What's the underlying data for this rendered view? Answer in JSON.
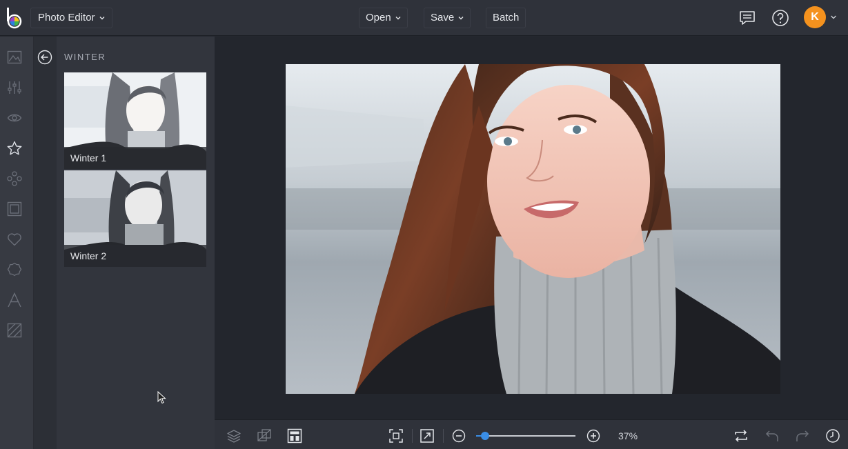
{
  "header": {
    "mode_label": "Photo Editor",
    "open_label": "Open",
    "save_label": "Save",
    "batch_label": "Batch",
    "avatar_initial": "K"
  },
  "sidebar": {
    "rail_icons": [
      "image-icon",
      "adjust-sliders-icon",
      "eye-icon",
      "star-icon",
      "effects-icon",
      "frame-icon",
      "heart-icon",
      "badge-icon",
      "text-icon",
      "texture-icon"
    ],
    "active_icon": "star-icon"
  },
  "panel": {
    "title": "WINTER",
    "items": [
      {
        "label": "Winter 1"
      },
      {
        "label": "Winter 2"
      }
    ]
  },
  "footer": {
    "zoom": "37%",
    "zoom_value": 0.08
  },
  "colors": {
    "accent": "#3a8ee6",
    "avatar": "#f5921e"
  }
}
